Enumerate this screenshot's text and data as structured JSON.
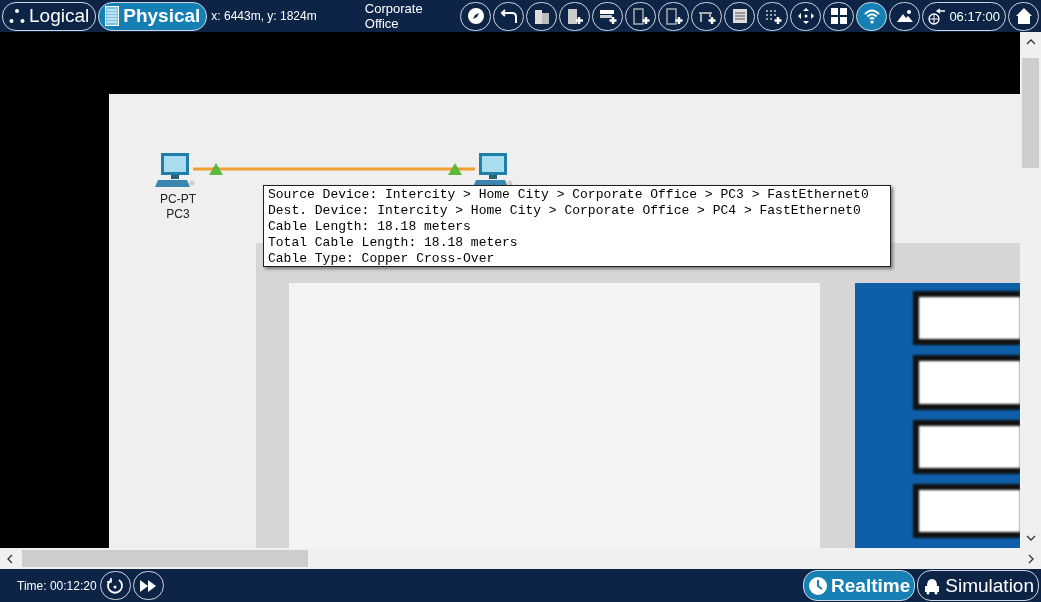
{
  "top_bar": {
    "views": [
      {
        "label": "Logical",
        "kind": "logical",
        "selected": false
      },
      {
        "label": "Physical",
        "kind": "physical",
        "selected": true
      }
    ],
    "coordinates": "x: 6443m, y: 1824m",
    "location": "Corporate Office",
    "tools": [
      {
        "kind": "compass",
        "selected": false
      },
      {
        "kind": "back",
        "selected": false
      },
      {
        "kind": "buildings",
        "selected": false
      },
      {
        "kind": "add-building",
        "selected": false
      },
      {
        "kind": "add-closet",
        "selected": false
      },
      {
        "kind": "add-rack",
        "selected": false
      },
      {
        "kind": "add-rack",
        "selected": false
      },
      {
        "kind": "add-table",
        "selected": false
      },
      {
        "kind": "list",
        "selected": false
      },
      {
        "kind": "add-grid",
        "selected": false
      },
      {
        "kind": "move",
        "selected": false
      },
      {
        "kind": "tiles",
        "selected": false
      },
      {
        "kind": "wireless",
        "selected": true
      },
      {
        "kind": "landscape",
        "selected": false
      }
    ],
    "clock": "06:17:00"
  },
  "canvas": {
    "devices": [
      {
        "model": "PC-PT",
        "name": "PC3"
      }
    ],
    "tooltip": [
      "Source Device: Intercity > Home City > Corporate Office > PC3 > FastEthernet0",
      "Dest. Device: Intercity > Home City > Corporate Office > PC4 > FastEthernet0",
      "Cable Length: 18.18 meters",
      "Total Cable Length: 18.18 meters",
      "Cable Type: Copper Cross-Over"
    ]
  },
  "bottom_bar": {
    "time": "Time: 00:12:20",
    "modes": [
      {
        "label": "Realtime",
        "kind": "realtime",
        "selected": true
      },
      {
        "label": "Simulation",
        "kind": "simulation",
        "selected": false
      }
    ]
  }
}
